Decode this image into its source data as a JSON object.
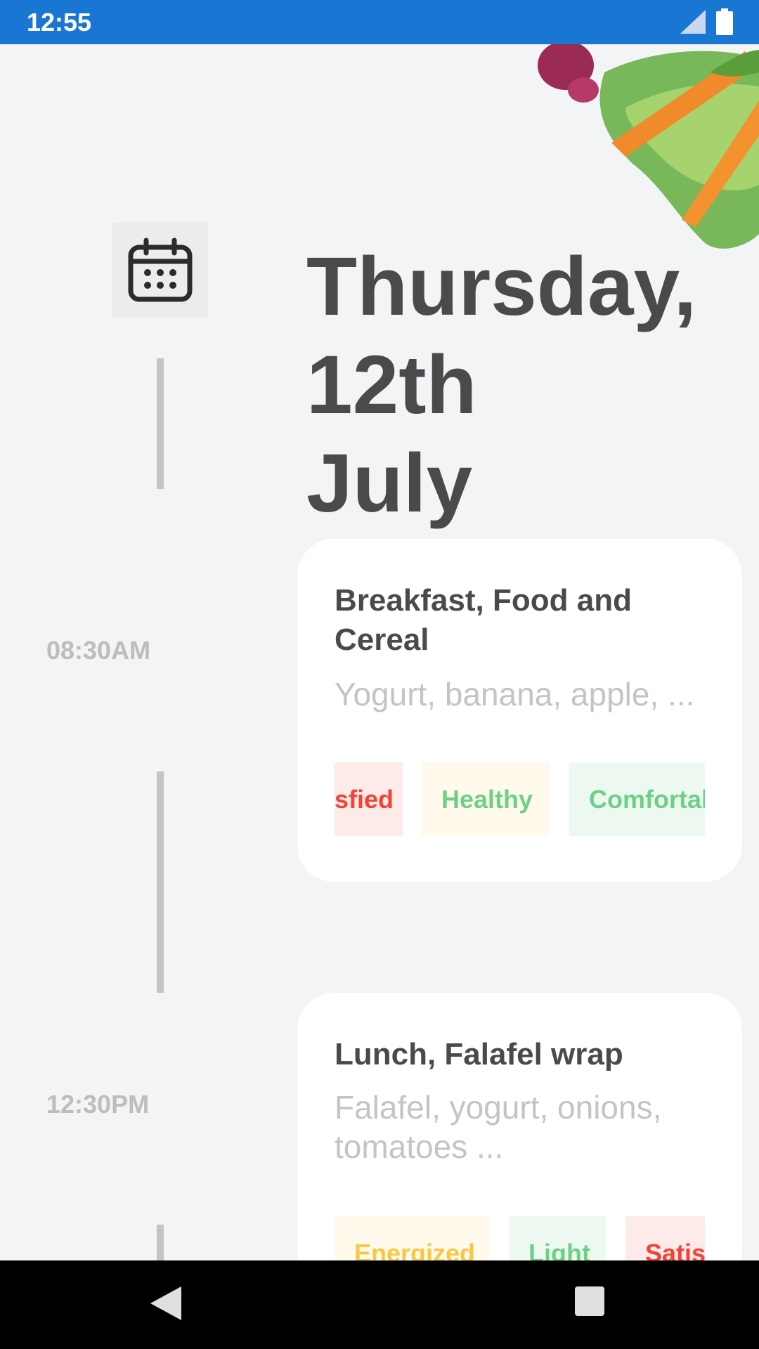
{
  "status_bar": {
    "time": "12:55",
    "background": "#1976d2"
  },
  "header": {
    "date_line1": "Thursday,",
    "date_line2": "12th",
    "date_line3": "July",
    "calendar_icon": "calendar-icon"
  },
  "meals": [
    {
      "time": "08:30AM",
      "title": "Breakfast, Food and Cereal",
      "description": "Yogurt, banana, apple, ...",
      "tags": [
        "sfied",
        "Healthy",
        "Comfortal"
      ]
    },
    {
      "time": "12:30PM",
      "title": "Lunch, Falafel wrap",
      "description": "Falafel, yogurt, onions, tomatoes ...",
      "tags": [
        "Energized",
        "Light",
        "Satis"
      ]
    }
  ],
  "nav": {
    "back_icon": "back-icon",
    "recent_icon": "recent-apps-icon"
  }
}
